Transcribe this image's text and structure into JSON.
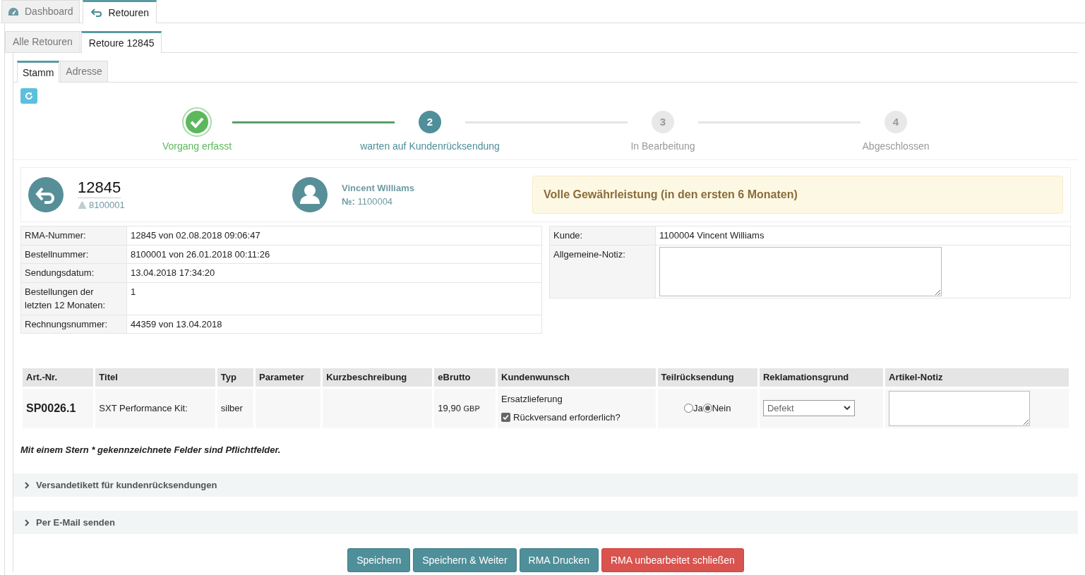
{
  "top_tabs": [
    {
      "label": "Dashboard",
      "kind": "dashboard",
      "selected": false
    },
    {
      "label": "Retouren",
      "kind": "returns",
      "selected": true
    }
  ],
  "sub_tabs": [
    {
      "label": "Alle Retouren",
      "selected": false
    },
    {
      "label": "Retoure 12845",
      "selected": true
    }
  ],
  "inner_tabs": [
    {
      "label": "Stamm",
      "selected": true
    },
    {
      "label": "Adresse",
      "selected": false
    }
  ],
  "steps": [
    {
      "label": "Vorgang erfasst",
      "done": true,
      "selected": false
    },
    {
      "number": "2",
      "label": "warten auf Kundenrücksendung",
      "done": false,
      "selected": true
    },
    {
      "number": "3",
      "label": "In Bearbeitung",
      "done": false,
      "selected": false
    },
    {
      "number": "4",
      "label": "Abgeschlossen",
      "done": false,
      "selected": false
    }
  ],
  "header": {
    "rma_number": "12845",
    "order_number": "8100001",
    "customer_name": "Vincent Williams",
    "customer_no_label": "№:",
    "customer_no": "1100004",
    "warranty": "Volle Gewährleistung (in den ersten 6 Monaten)"
  },
  "info_left": [
    {
      "label": "RMA-Nummer:",
      "value": "12845 von 02.08.2018 09:06:47"
    },
    {
      "label": "Bestellnummer:",
      "value": "8100001 von 26.01.2018 00:11:26"
    },
    {
      "label": "Sendungsdatum:",
      "value": "13.04.2018 17:34:20"
    },
    {
      "label": "Bestellungen der letzten 12 Monaten:",
      "value": "1"
    },
    {
      "label": "Rechnungsnummer:",
      "value": "44359 von 13.04.2018"
    }
  ],
  "info_right": {
    "customer_label": "Kunde:",
    "customer_value": "1100004 Vincent Williams",
    "note_label": "Allgemeine-Notiz:"
  },
  "items": {
    "columns": [
      "Art.-Nr.",
      "Titel",
      "Typ",
      "Parameter",
      "Kurzbeschreibung",
      "eBrutto",
      "Kundenwunsch",
      "Teilrücksendung",
      "Reklamationsgrund",
      "Artikel-Notiz"
    ],
    "rows": [
      {
        "art_nr": "SP0026.1",
        "title": "SXT Performance Kit:",
        "type": "silber",
        "price": "19,90",
        "currency": "GBP",
        "wish": "Ersatzlieferung",
        "return_required": {
          "label": "Rückversand erforderlich?",
          "checked": true
        },
        "partial": [
          {
            "label": "Ja",
            "selected": false
          },
          {
            "label": "Nein",
            "selected": true
          }
        ],
        "reason": "Defekt"
      }
    ]
  },
  "notice": "Mit einem Stern * gekennzeichnete Felder sind Pflichtfelder.",
  "sections": [
    {
      "title": "Versandetikett für kundenrücksendungen",
      "expanded": false
    },
    {
      "title": "Per E-Mail senden",
      "expanded": false
    }
  ],
  "buttons": [
    {
      "label": "Speichern",
      "kind": "primary"
    },
    {
      "label": "Speichern & Weiter",
      "kind": "primary"
    },
    {
      "label": "RMA Drucken",
      "kind": "primary"
    },
    {
      "label": "RMA unbearbeitet schließen",
      "kind": "danger"
    }
  ]
}
